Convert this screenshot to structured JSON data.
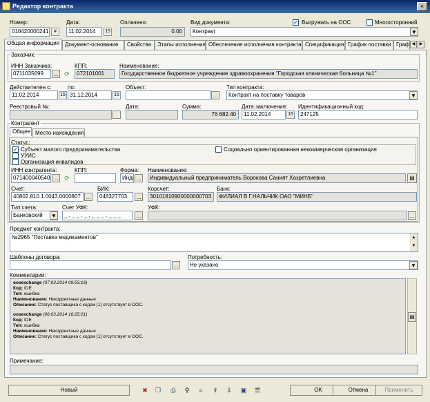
{
  "window": {
    "title": "Редактор контракта",
    "close": "×"
  },
  "header": {
    "number_label": "Номер:",
    "number_value": "010420000241",
    "date_label": "Дата:",
    "date_value": "11.02.2014",
    "paid_label": "Оплачено:",
    "paid_value": "0.00",
    "doctype_label": "Вид документа:",
    "doctype_value": "Контракт",
    "export_label": "Выгружать на ООС",
    "export_checked": true,
    "multi_label": "Многосторонний",
    "multi_checked": false
  },
  "tabs": [
    "Общая информация",
    "Документ-основание",
    "Свойства",
    "Этапы исполнения",
    "Обеспечение исполнения контракта",
    "Спецификация",
    "График поставки",
    "Граф"
  ],
  "customer": {
    "group_label": "Заказчик:",
    "inn_label": "ИНН Заказчика:",
    "inn_value": "0711035699",
    "kpp_label": "КПП:",
    "kpp_value": "072101001",
    "name_label": "Наименование:",
    "name_value": "Государственное бюджетное учреждение здравоохранения \"Городская клиническая больница №1\""
  },
  "dates": {
    "from_label": "Действителен с:",
    "from_value": "11.02.2014",
    "to_label": "по:",
    "to_value": "31.12.2014",
    "object_label": "Объект:",
    "object_value": "",
    "ctype_label": "Тип контракта:",
    "ctype_value": "Контракт на поставку товаров"
  },
  "registry": {
    "reg_label": "Реестровый №:",
    "reg_value": "",
    "date_label": "Дата:",
    "date_value": "",
    "sum_label": "Сумма:",
    "sum_value": "76 682.40",
    "conclusion_label": "Дата заключения:",
    "conclusion_value": "11.02.2014",
    "id_label": "Идентификационный код:",
    "id_value": "247125"
  },
  "contractor": {
    "group_label": "Контрагент",
    "subtabs": [
      "Общее",
      "Место нахождения"
    ],
    "status_label": "Статус:",
    "statuses": [
      {
        "label": "Субъект малого предпринимательства",
        "checked": true
      },
      {
        "label": "УУИС",
        "checked": false
      },
      {
        "label": "Организация инвалидов",
        "checked": false
      },
      {
        "label": "Социально ориентированная некоммерческая организация",
        "checked": false
      }
    ],
    "inn_label": "ИНН контрагента:",
    "inn_value": "071400040540",
    "kpp_label": "КПП:",
    "kpp_value": "",
    "form_label": "Форма:",
    "form_value": "Инди",
    "name_label": "Наименование:",
    "name_value": "Индивидуальный предприниматель Ворокова Саният Хазретлиевна",
    "account_label": "Счет:",
    "account_value": "40802.810.1.0043.0000807",
    "bik_label": "БИК:",
    "bik_value": "048327703",
    "corr_label": "Корсчет:",
    "corr_value": "30101810900000000703",
    "bank_label": "Банк:",
    "bank_value": "ФИЛИАЛ В Г.НАЛЬЧИК ОАО \"МИНБ\"",
    "acctype_label": "Тип счета:",
    "acctype_value": "Банковский",
    "ufk_acc_label": "Счет УФК:",
    "ufk_acc_value": "_ . _ _ . _ . _ _ _ . _ _ _",
    "ufk_label": "УФК:",
    "ufk_value": ""
  },
  "subject": {
    "label": "Предмет контракта:",
    "value": "№2965 \"Поставка медикаментов\""
  },
  "templates": {
    "label": "Шаблоны договора:",
    "value": ""
  },
  "need": {
    "label": "Потребность:",
    "value": "Не указано"
  },
  "comments": {
    "label": "Комментарии:",
    "entries": [
      {
        "user": "oosexchange",
        "time": "(07.03.2014 09:53:16)",
        "code_k": "Код:",
        "code": "IDE",
        "type_k": "Тип:",
        "type": "ошибка",
        "name_k": "Наименование:",
        "name": "Некорректные данные",
        "desc_k": "Описание:",
        "desc": "Статус поставщика с кодом [1] отсутствует в ООС."
      },
      {
        "user": "oosexchange",
        "time": "(06.03.2014 16:25:21)",
        "code_k": "Код:",
        "code": "IDE",
        "type_k": "Тип:",
        "type": "ошибка",
        "name_k": "Наименование:",
        "name": "Некорректные данные",
        "desc_k": "Описание:",
        "desc": "Статус поставщика с кодом [1] отсутствует в ООС."
      }
    ]
  },
  "note": {
    "label": "Примечание:",
    "value": ""
  },
  "footer": {
    "new": "Новый",
    "ok": "OK",
    "cancel": "Отмена",
    "apply": "Применить"
  },
  "icons": {
    "calendar": "calendar-icon",
    "ellipsis": "...",
    "green": "#3a9a3a"
  }
}
